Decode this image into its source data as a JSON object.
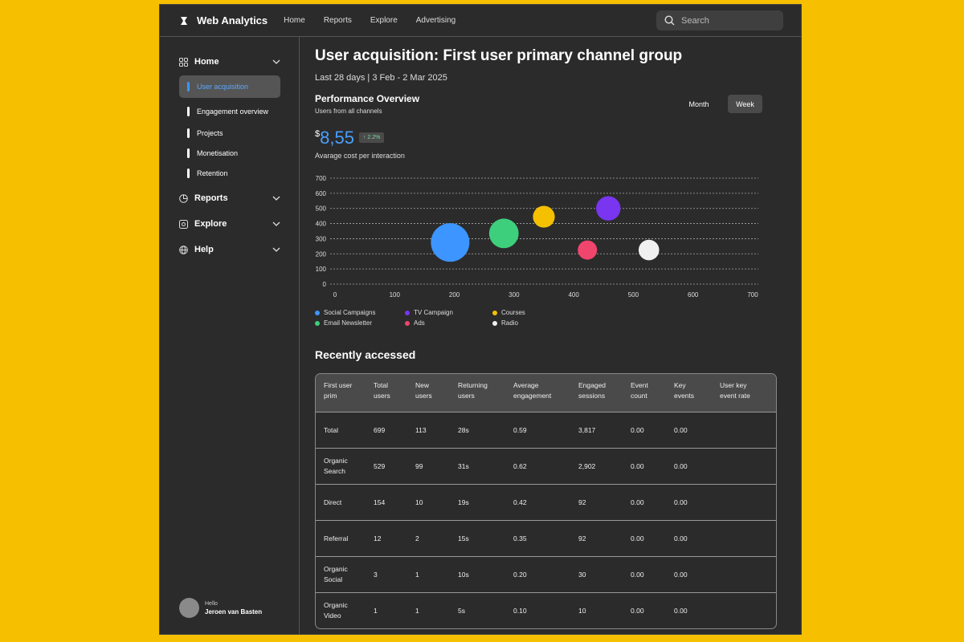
{
  "app": {
    "name": "Web Analytics"
  },
  "topnav": [
    "Home",
    "Reports",
    "Explore",
    "Advertising"
  ],
  "search": {
    "placeholder": "Search"
  },
  "sidebar": {
    "sections": [
      {
        "label": "Home",
        "icon": "grid-icon"
      },
      {
        "label": "Reports",
        "icon": "pie-chart-icon"
      },
      {
        "label": "Explore",
        "icon": "explore-icon"
      },
      {
        "label": "Help",
        "icon": "globe-icon"
      }
    ],
    "home_items": [
      "User acquisition",
      "Engagement overview",
      "Projects",
      "Monetisation",
      "Retention"
    ],
    "active_item": "User acquisition"
  },
  "user": {
    "greeting": "Hello",
    "name": "Jeroen van Basten"
  },
  "page": {
    "title": "User acquisition: First user primary channel group",
    "date_range": "Last 28 days | 3 Feb - 2 Mar 2025"
  },
  "performance": {
    "title": "Performance Overview",
    "subtitle": "Users from all channels",
    "toggle": [
      "Month",
      "Week"
    ],
    "toggle_selected": "Week",
    "currency": "$",
    "value": "8,55",
    "change": "2.2%",
    "value_label": "Avarage cost per interaction"
  },
  "chart_data": {
    "type": "scatter",
    "title": "",
    "xlabel": "",
    "ylabel": "",
    "xlim": [
      0,
      700
    ],
    "ylim": [
      0,
      700
    ],
    "x_ticks": [
      0,
      100,
      200,
      300,
      400,
      500,
      600,
      700
    ],
    "y_ticks": [
      0,
      100,
      200,
      300,
      400,
      500,
      600,
      700
    ],
    "grid": "horizontal dashed",
    "legend_position": "bottom",
    "series": [
      {
        "name": "Social Campaigns",
        "color": "#3d95ff",
        "x": 193,
        "y": 275,
        "size": 3
      },
      {
        "name": "Ads",
        "color": "#f0456d",
        "x": 423,
        "y": 225,
        "size": 1.5
      },
      {
        "name": "Email Newsletter",
        "color": "#3ecf7c",
        "x": 283,
        "y": 335,
        "size": 2.3
      },
      {
        "name": "Courses",
        "color": "#f5c000",
        "x": 350,
        "y": 445,
        "size": 1.7
      },
      {
        "name": "TV Campaign",
        "color": "#7a35f0",
        "x": 458,
        "y": 500,
        "size": 1.9
      },
      {
        "name": "Radio",
        "color": "#f0f0f0",
        "x": 526,
        "y": 225,
        "size": 1.6
      }
    ]
  },
  "recent": {
    "title": "Recently accessed",
    "columns": [
      [
        "First user",
        "prim"
      ],
      [
        "Total",
        "users"
      ],
      [
        "New",
        "users"
      ],
      [
        "Returning",
        "users"
      ],
      [
        "Average",
        "engagement"
      ],
      [
        "Engaged",
        "sessions"
      ],
      [
        "Event",
        "count"
      ],
      [
        "Key",
        "events"
      ],
      [
        "User key",
        "event rate"
      ]
    ],
    "rows": [
      [
        [
          "Total"
        ],
        "699",
        "113",
        "28s",
        "0.59",
        "3,817",
        "0.00",
        "0.00",
        ""
      ],
      [
        [
          "Organic",
          "Search"
        ],
        "529",
        "99",
        "31s",
        "0.62",
        "2,902",
        "0.00",
        "0.00",
        ""
      ],
      [
        [
          "Direct"
        ],
        "154",
        "10",
        "19s",
        "0.42",
        "92",
        "0.00",
        "0.00",
        ""
      ],
      [
        [
          "Referral"
        ],
        "12",
        "2",
        "15s",
        "0.35",
        "92",
        "0.00",
        "0.00",
        ""
      ],
      [
        [
          "Organic",
          "Social"
        ],
        "3",
        "1",
        "10s",
        "0.20",
        "30",
        "0.00",
        "0.00",
        ""
      ],
      [
        [
          "Organic",
          "Video"
        ],
        "1",
        "1",
        "5s",
        "0.10",
        "10",
        "0.00",
        "0.00",
        ""
      ]
    ]
  }
}
